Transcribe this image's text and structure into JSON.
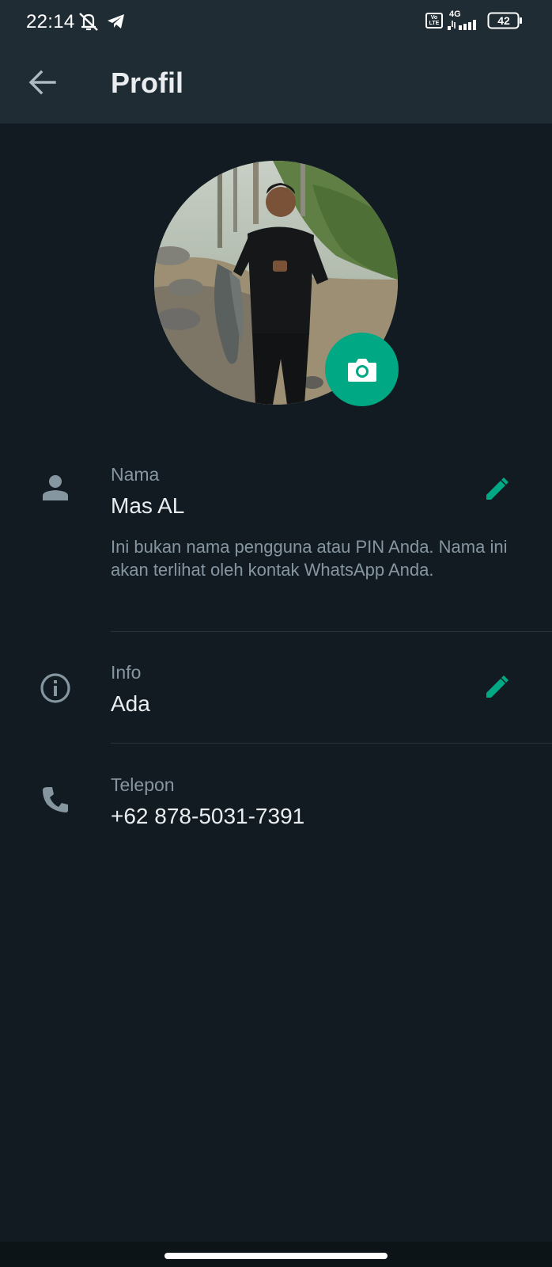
{
  "status_bar": {
    "time": "22:14",
    "network": "4G",
    "volte": "Vo LTE",
    "battery": "42",
    "icons": [
      "muted-notification-icon",
      "telegram-icon",
      "volte-icon",
      "signal-icon",
      "battery-icon"
    ]
  },
  "app_bar": {
    "title": "Profil",
    "back_icon": "arrow-left-icon"
  },
  "profile": {
    "name_label": "Nama",
    "name_value": "Mas AL",
    "name_helper": "Ini bukan nama pengguna atau PIN Anda. Nama ini akan terlihat oleh kontak WhatsApp Anda.",
    "info_label": "Info",
    "info_value": "Ada",
    "phone_label": "Telepon",
    "phone_value": "+62 878-5031-7391"
  },
  "colors": {
    "accent": "#00a884",
    "background": "#121b22",
    "app_bar": "#1f2c33",
    "secondary_text": "#8696a0",
    "primary_text": "#e9edef"
  }
}
